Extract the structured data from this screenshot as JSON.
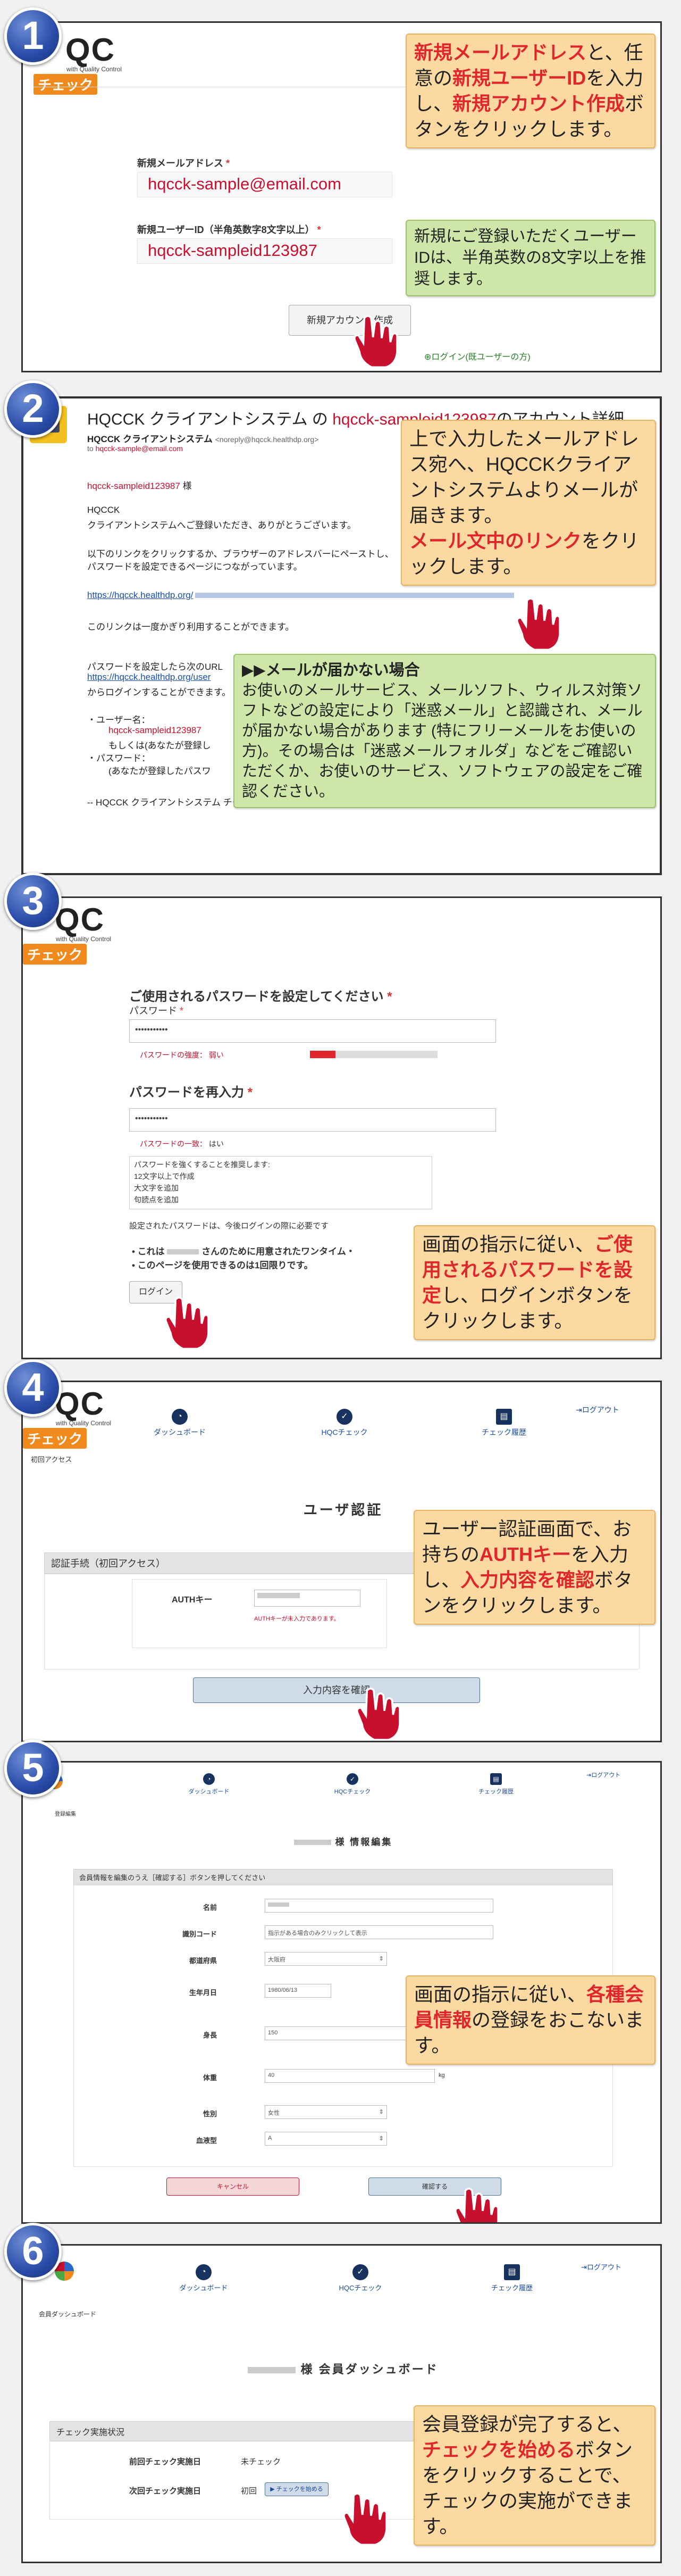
{
  "step1": {
    "num": "1",
    "logo_qc": "QC",
    "logo_sub": "with Quality Control",
    "logo_check": "チェック",
    "callout_parts": [
      "新規メールアドレス",
      "と、任意の",
      "新規ユーザーID",
      "を入力し、",
      "新規アカウント作成",
      "ボタンをクリックします。"
    ],
    "email_label": "新規メールアドレス",
    "email_value": "hqcck-sample@email.com",
    "userid_label": "新規ユーザーID（半角英数字8文字以上）",
    "userid_value": "hqcck-sampleid123987",
    "green_callout": "新規にご登録いただくユーザーIDは、半角英数の8文字以上を推奨します。",
    "create_button": "新規アカウント作成",
    "login_link": "ログイン(既ユーザーの方)"
  },
  "step2": {
    "num": "2",
    "subject_prefix": "HQCCK クライアントシステム の ",
    "subject_id": "hqcck-sampleid123987",
    "subject_suffix": "のアカウント詳細",
    "sender": "HQCCK クライアントシステム",
    "sender_addr": "<noreply@hqcck.healthdp.org>",
    "to_label": "to",
    "to_addr": "hqcck-sample@email.com",
    "greeting_id": "hqcck-sampleid123987",
    "greeting_suffix": " 様",
    "body1": "HQCCK",
    "body2": "クライアントシステムへご登録いただき、ありがとうございます。",
    "body3": "以下のリンクをクリックするか、ブラウザーのアドレスバーにペーストし、",
    "body4": "パスワードを設定できるページにつながっています。",
    "link1": "https://hqcck.healthdp.org/",
    "body5": "このリンクは一度かぎり利用することができます。",
    "body6": "パスワードを設定したら次のURL",
    "link2": "https://hqcck.healthdp.org/user",
    "body7": "からログインすることができます。",
    "user_label": "・ユーザー名：",
    "user_value": "hqcck-sampleid123987",
    "user_note": "もしくは(あなたが登録し",
    "pass_label": "・パスワード：",
    "pass_note": "(あなたが登録したパスワ",
    "team": "-- HQCCK クライアントシステム チーム",
    "callout_text": "上で入力したメールアドレス宛へ、HQCCKクライアントシステムよりメールが届きます。",
    "callout_red": "メール文中のリンク",
    "callout_end": "をクリックします。",
    "green_title": "▶▶メールが届かない場合",
    "green_body": "お使いのメールサービス、メールソフト、ウィルス対策ソフトなどの設定により「迷惑メール」と認識され、メールが届かない場合があります (特にフリーメールをお使いの方)。その場合は「迷惑メールフォルダ」などをご確認いただくか、お使いのサービス、ソフトウェアの設定をご確認ください。"
  },
  "step3": {
    "num": "3",
    "title": "ご使用されるパスワードを設定してください",
    "pw_label": "パスワード",
    "pw_value": "•••••••••••",
    "strength_label": "パスワードの強度：",
    "strength_value": "弱い",
    "strength_fraction": 0.2,
    "reenter_title": "パスワードを再入力",
    "match_label": "パスワードの一致：",
    "match_value": "はい",
    "tips": [
      "パスワードを強くすることを推奨します:",
      "12文字以上で作成",
      "大文字を追加",
      "句読点を追加"
    ],
    "note": "設定されたパスワードは、今後ログインの際に必要です",
    "bullet1": "• これは",
    "bullet1b": "さんのために用意されたワンタイム・",
    "bullet2": "• このページを使用できるのは1回限りです。",
    "login_button": "ログイン",
    "callout_a": "画面の指示に従い、",
    "callout_red": "ご使用されるパスワードを設定",
    "callout_b": "し、ログインボタンをクリックします。"
  },
  "step4": {
    "num": "4",
    "nav": [
      "ダッシュボード",
      "HQCチェック",
      "チェック履歴"
    ],
    "logout": "ログアウト",
    "breadcrumb": "初回アクセス",
    "title": "ユーザ認証",
    "section": "認証手続（初回アクセス）",
    "auth_label": "AUTHキー",
    "auth_hint": "AUTHキーが未入力であります。",
    "confirm_button": "入力内容を確認",
    "callout_a": "ユーザー認証画面で、お持ちの",
    "callout_red1": "AUTHキー",
    "callout_b": "を入力し、",
    "callout_red2": "入力内容を確認",
    "callout_c": "ボタンをクリックします。"
  },
  "step5": {
    "num": "5",
    "nav": [
      "ダッシュボード",
      "HQCチェック",
      "チェック履歴"
    ],
    "logout": "ログアウト",
    "breadcrumb": "登録編集",
    "title": "様 情報編集",
    "section": "会員情報を編集のうえ［確認する］ボタンを押してください",
    "fields": [
      "名前",
      "識別コード",
      "都道府県",
      "生年月日",
      "身長",
      "体重",
      "性別",
      "血液型"
    ],
    "values": [
      "",
      "指示がある場合のみクリックして表示",
      "大阪府",
      "1980/06/13",
      "150",
      "40",
      "女性",
      "A"
    ],
    "unit_height": "cm",
    "unit_weight": "kg",
    "cancel_button": "キャンセル",
    "confirm_button": "確認する",
    "callout_a": "画面の指示に従い、",
    "callout_red": "各種会員情報",
    "callout_b": "の登録をおこないます。"
  },
  "step6": {
    "num": "6",
    "nav": [
      "ダッシュボード",
      "HQCチェック",
      "チェック履歴"
    ],
    "logout": "ログアウト",
    "breadcrumb": "会員ダッシュボード",
    "title": "様 会員ダッシュボード",
    "section": "チェック実施状況",
    "row1_label": "前回チェック実施日",
    "row1_value": "未チェック",
    "row2_label": "次回チェック実施日",
    "row2_value": "初回",
    "start_button": "チェックを始める",
    "callout_a": "会員登録が完了すると、",
    "callout_red": "チェックを始める",
    "callout_b": "ボタンをクリックすることで、チェックの実施ができます。"
  }
}
